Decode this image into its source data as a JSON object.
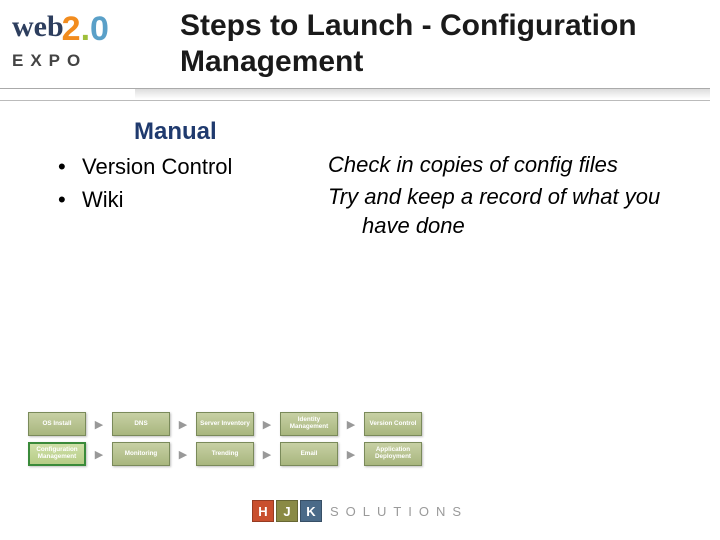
{
  "logo": {
    "web": "web",
    "two": "2",
    "dot": ".",
    "zero": "0",
    "expo": "EXPO"
  },
  "title": "Steps to Launch - Configuration Management",
  "subhead": "Manual",
  "bullets": [
    "Version Control",
    "Wiki"
  ],
  "notes": [
    "Check in copies of config files",
    "Try and keep a record of what you have done"
  ],
  "flow": {
    "items": [
      {
        "label": "OS Install",
        "active": false
      },
      {
        "label": "DNS",
        "active": false
      },
      {
        "label": "Server Inventory",
        "active": false
      },
      {
        "label": "Identity Management",
        "active": false
      },
      {
        "label": "Version Control",
        "active": false
      },
      {
        "label": "Configuration Management",
        "active": true
      },
      {
        "label": "Monitoring",
        "active": false
      },
      {
        "label": "Trending",
        "active": false
      },
      {
        "label": "Email",
        "active": false
      },
      {
        "label": "Application Deployment",
        "active": false
      }
    ]
  },
  "footer": {
    "h": "H",
    "j": "J",
    "k": "K",
    "txt": "SOLUTIONS"
  }
}
